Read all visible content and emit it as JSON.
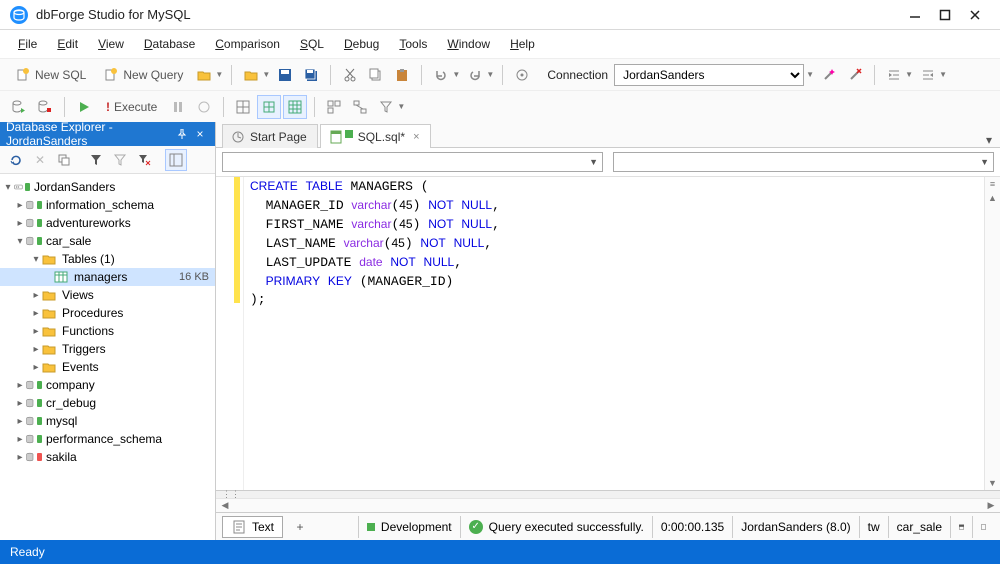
{
  "titlebar": {
    "title": "dbForge Studio for MySQL"
  },
  "menu": [
    "File",
    "Edit",
    "View",
    "Database",
    "Comparison",
    "SQL",
    "Debug",
    "Tools",
    "Window",
    "Help"
  ],
  "toolbar1": {
    "new_sql": "New SQL",
    "new_query": "New Query",
    "connection_label": "Connection",
    "connection_value": "JordanSanders"
  },
  "toolbar2": {
    "execute": "Execute"
  },
  "sidebar": {
    "title": "Database Explorer - JordanSanders",
    "root": {
      "label": "JordanSanders"
    },
    "databases": [
      {
        "label": "information_schema",
        "status": "green"
      },
      {
        "label": "adventureworks",
        "status": "green"
      },
      {
        "label": "car_sale",
        "status": "green",
        "expanded": true,
        "children": [
          {
            "label": "Tables (1)",
            "type": "folder",
            "expanded": true,
            "children": [
              {
                "label": "managers",
                "type": "table",
                "size": "16 KB",
                "selected": true
              }
            ]
          },
          {
            "label": "Views",
            "type": "folder"
          },
          {
            "label": "Procedures",
            "type": "folder"
          },
          {
            "label": "Functions",
            "type": "folder"
          },
          {
            "label": "Triggers",
            "type": "folder"
          },
          {
            "label": "Events",
            "type": "folder"
          }
        ]
      },
      {
        "label": "company",
        "status": "green"
      },
      {
        "label": "cr_debug",
        "status": "green"
      },
      {
        "label": "mysql",
        "status": "green"
      },
      {
        "label": "performance_schema",
        "status": "green"
      },
      {
        "label": "sakila",
        "status": "red"
      }
    ]
  },
  "tabs": [
    {
      "label": "Start Page",
      "icon": "start",
      "closable": false
    },
    {
      "label": "SQL.sql*",
      "icon": "sql",
      "closable": true,
      "active": true
    }
  ],
  "code_lines": [
    [
      [
        "CREATE",
        "kw"
      ],
      [
        " "
      ],
      [
        "TABLE",
        "kw"
      ],
      [
        " MANAGERS ("
      ]
    ],
    [
      [
        "  MANAGER_ID "
      ],
      [
        "varchar",
        "ty"
      ],
      [
        "("
      ],
      [
        "45",
        "num"
      ],
      [
        ") "
      ],
      [
        "NOT",
        "null"
      ],
      [
        " "
      ],
      [
        "NULL",
        "null"
      ],
      [
        ","
      ]
    ],
    [
      [
        "  FIRST_NAME "
      ],
      [
        "varchar",
        "ty"
      ],
      [
        "("
      ],
      [
        "45",
        "num"
      ],
      [
        ") "
      ],
      [
        "NOT",
        "null"
      ],
      [
        " "
      ],
      [
        "NULL",
        "null"
      ],
      [
        ","
      ]
    ],
    [
      [
        "  LAST_NAME "
      ],
      [
        "varchar",
        "ty"
      ],
      [
        "("
      ],
      [
        "45",
        "num"
      ],
      [
        ") "
      ],
      [
        "NOT",
        "null"
      ],
      [
        " "
      ],
      [
        "NULL",
        "null"
      ],
      [
        ","
      ]
    ],
    [
      [
        "  LAST_UPDATE "
      ],
      [
        "date",
        "ty"
      ],
      [
        " "
      ],
      [
        "NOT",
        "null"
      ],
      [
        " "
      ],
      [
        "NULL",
        "null"
      ],
      [
        ","
      ]
    ],
    [
      [
        "  "
      ],
      [
        "PRIMARY",
        "kw"
      ],
      [
        " "
      ],
      [
        "KEY",
        "kw"
      ],
      [
        " (MANAGER_ID)"
      ]
    ],
    [
      [
        ");"
      ]
    ]
  ],
  "highlight_line": 6,
  "footer": {
    "text_tab": "Text",
    "env": "Development",
    "status": "Query executed successfully.",
    "time": "0:00:00.135",
    "conn": "JordanSanders (8.0)",
    "db_extra": "tw",
    "db": "car_sale"
  },
  "statusbar": {
    "text": "Ready"
  }
}
